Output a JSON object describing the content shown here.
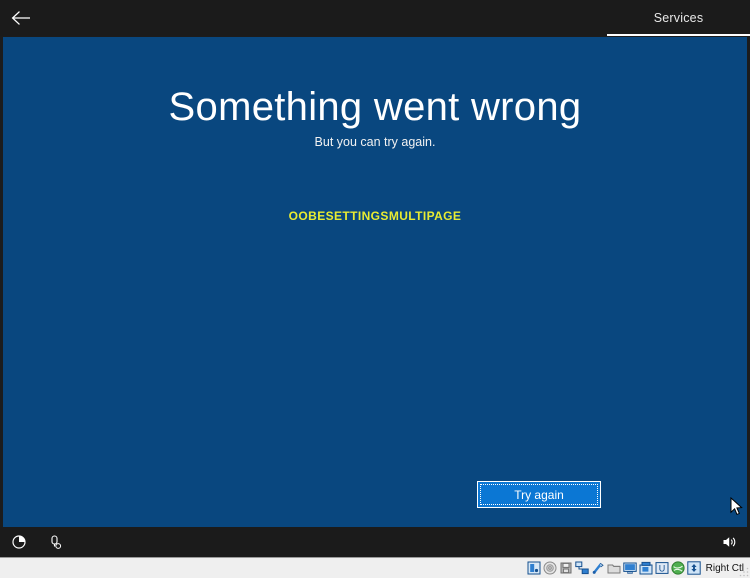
{
  "window": {
    "vm_background_color": "#1c1c1c",
    "oobe_blue": "#09477f"
  },
  "oobe": {
    "header": {
      "back_icon": "back-arrow-icon",
      "tab_label": "Services",
      "tab_active": true
    },
    "content": {
      "title": "Something went wrong",
      "subtitle": "But you can try again.",
      "error_code": "OOBESETTINGSMULTIPAGE",
      "error_code_color": "#e8eb32"
    },
    "actions": {
      "try_again_label": "Try again",
      "try_again_focused": true,
      "accent_color": "#0b77d4"
    },
    "footer": {
      "ease_of_access_icon": "ease-of-access-icon",
      "input_method_icon": "input-method-icon",
      "volume_icon": "volume-speaker-icon"
    }
  },
  "statusbar": {
    "host_key_label": "Right Ctl",
    "indicators": [
      {
        "name": "hard-disk-icon"
      },
      {
        "name": "optical-disk-icon"
      },
      {
        "name": "floppy-disk-icon"
      },
      {
        "name": "network-icon"
      },
      {
        "name": "usb-icon"
      },
      {
        "name": "shared-folder-icon"
      },
      {
        "name": "display-icon"
      },
      {
        "name": "video-capture-icon"
      },
      {
        "name": "remote-desktop-icon"
      },
      {
        "name": "guest-additions-icon"
      },
      {
        "name": "mouse-capture-icon"
      }
    ]
  }
}
